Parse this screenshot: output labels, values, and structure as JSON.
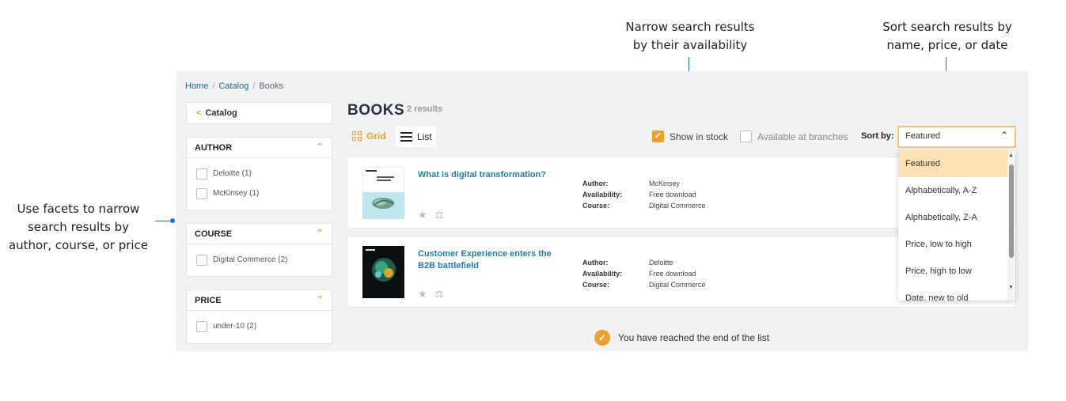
{
  "callouts": {
    "facets_line1": "Use facets to narrow",
    "facets_line2": "search results by",
    "facets_line3": "author, course, or price",
    "availability_line1": "Narrow search results",
    "availability_line2": "by their availability",
    "sort_line1": "Sort search results by",
    "sort_line2": "name, price, or date"
  },
  "breadcrumb": {
    "home": "Home",
    "catalog": "Catalog",
    "current": "Books"
  },
  "sidebar": {
    "back_label": "Catalog",
    "facets": [
      {
        "title": "AUTHOR",
        "options": [
          "Deloitte (1)",
          "McKinsey (1)"
        ]
      },
      {
        "title": "COURSE",
        "options": [
          "Digital Commerce (2)"
        ]
      },
      {
        "title": "PRICE",
        "options": [
          "under-10 (2)"
        ]
      }
    ]
  },
  "results": {
    "title": "BOOKS",
    "count": "2 results",
    "view_grid": "Grid",
    "view_list": "List",
    "filter_in_stock": "Show in stock",
    "filter_in_stock_checked": true,
    "filter_branches": "Available at branches",
    "filter_branches_checked": false,
    "sort_label": "Sort by:",
    "sort_value": "Featured",
    "sort_options": [
      "Featured",
      "Alphabetically, A-Z",
      "Alphabetically, Z-A",
      "Price, low to high",
      "Price, high to low",
      "Date, new to old"
    ],
    "meta_labels": {
      "author": "Author:",
      "availability": "Availability:",
      "course": "Course:"
    },
    "items": [
      {
        "title": "What is digital transformation?",
        "author": "McKinsey",
        "availability": "Free download",
        "course": "Digital Commerce"
      },
      {
        "title": "Customer Experience enters the B2B battlefield",
        "author": "Deloitte",
        "availability": "Free download",
        "course": "Digital Commerce"
      }
    ],
    "end_message": "You have reached the end of the list"
  },
  "colors": {
    "accent": "#f0a030",
    "link": "#1d7fa3",
    "callout": "#1a73c8"
  }
}
